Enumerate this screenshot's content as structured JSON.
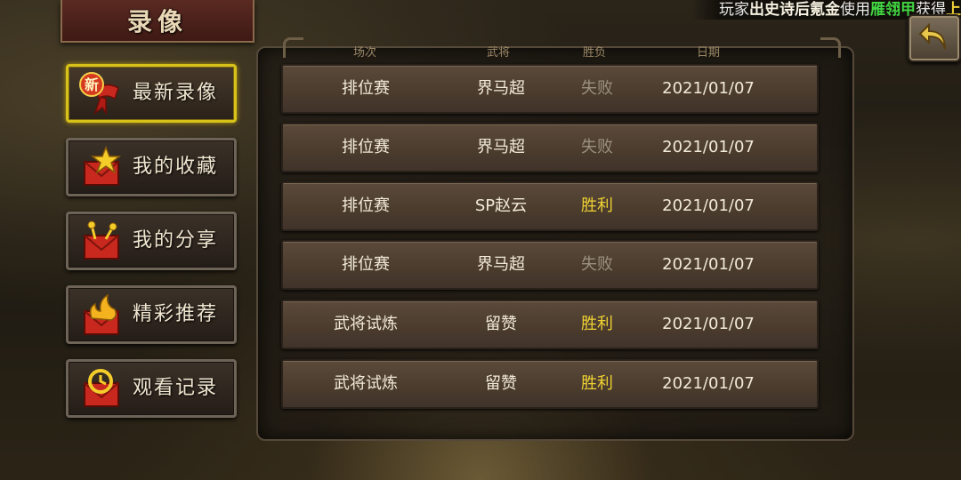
{
  "title": "录像",
  "ticker": {
    "prefix": "玩家",
    "player": "出史诗后氪金",
    "mid": "使用",
    "item": "雁翎甲",
    "suffix": "获得",
    "tail": "上"
  },
  "menu": [
    {
      "label": "最新录像",
      "badge": "新",
      "active": true
    },
    {
      "label": "我的收藏"
    },
    {
      "label": "我的分享"
    },
    {
      "label": "精彩推荐"
    },
    {
      "label": "观看记录"
    }
  ],
  "table": {
    "headers": [
      "场次",
      "武将",
      "胜负",
      "日期"
    ],
    "rows": [
      {
        "mode": "排位赛",
        "general": "界马超",
        "result": "失败",
        "date": "2021/01/07"
      },
      {
        "mode": "排位赛",
        "general": "界马超",
        "result": "失败",
        "date": "2021/01/07"
      },
      {
        "mode": "排位赛",
        "general": "SP赵云",
        "result": "胜利",
        "date": "2021/01/07"
      },
      {
        "mode": "排位赛",
        "general": "界马超",
        "result": "失败",
        "date": "2021/01/07"
      },
      {
        "mode": "武将试炼",
        "general": "留赞",
        "result": "胜利",
        "date": "2021/01/07"
      },
      {
        "mode": "武将试炼",
        "general": "留赞",
        "result": "胜利",
        "date": "2021/01/07"
      }
    ]
  },
  "colors": {
    "win": "#f0d232",
    "lose": "#9b9080",
    "active_border": "#d8c21a"
  }
}
